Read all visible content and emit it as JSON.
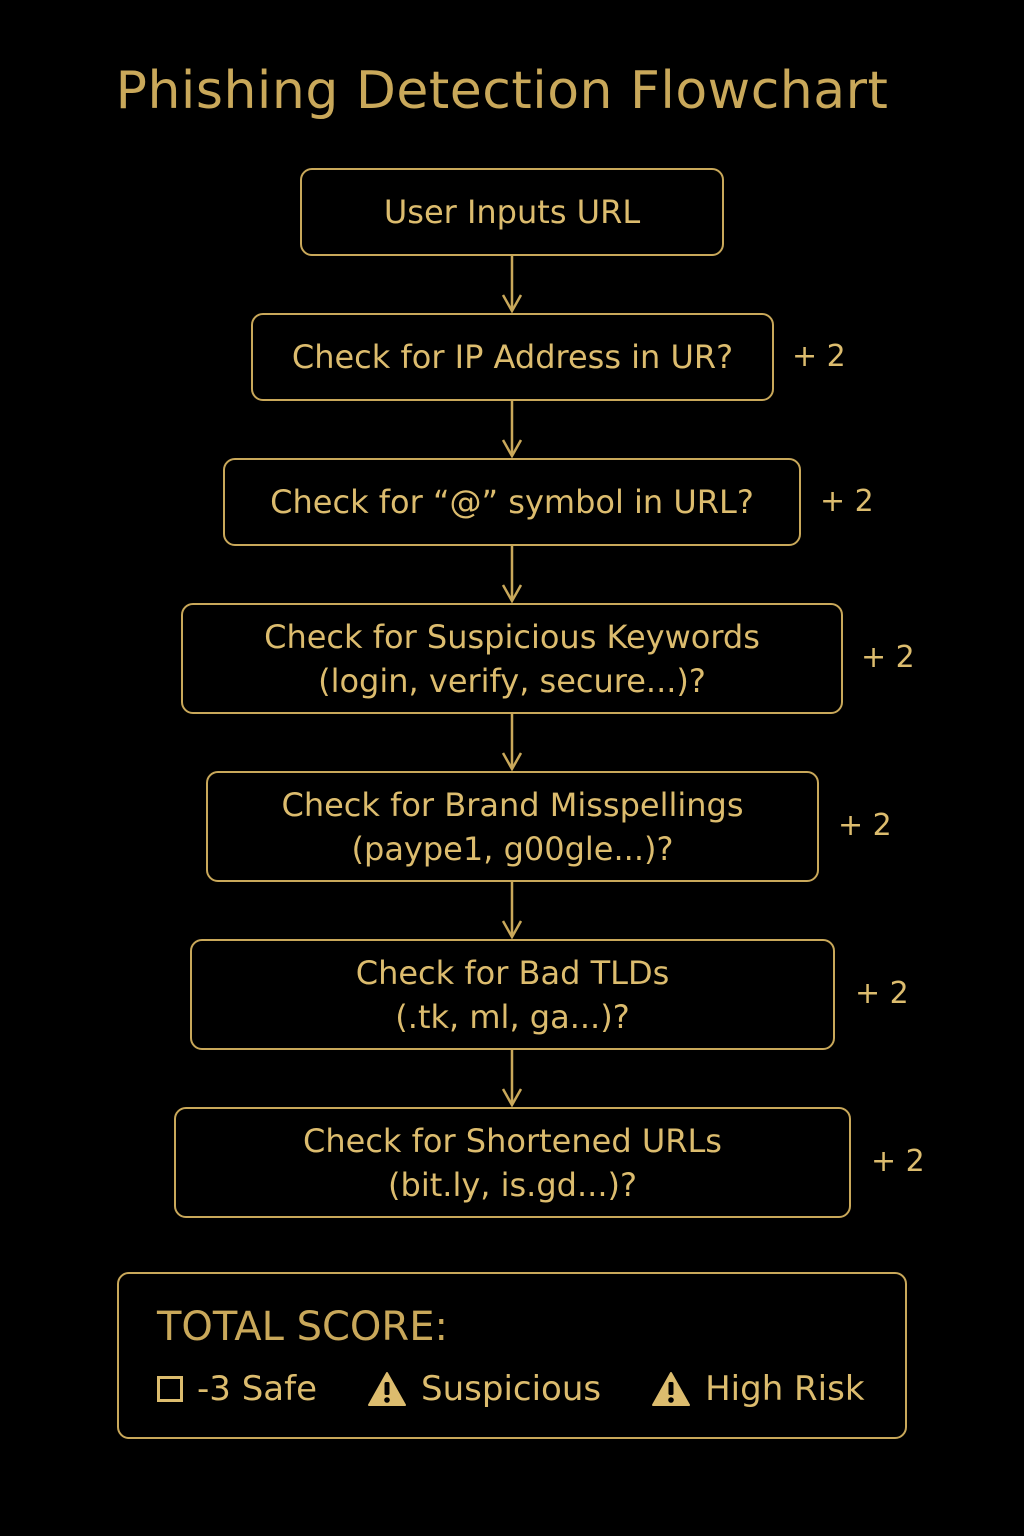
{
  "title": "Phishing Detection Flowchart",
  "steps": [
    {
      "lines": [
        "User Inputs URL"
      ],
      "score": ""
    },
    {
      "lines": [
        "Check for IP Address in UR?"
      ],
      "score": "+ 2"
    },
    {
      "lines": [
        "Check for “@” symbol in URL?"
      ],
      "score": "+ 2"
    },
    {
      "lines": [
        "Check for Suspicious Keywords",
        "(login, verify, secure...)?"
      ],
      "score": "+ 2"
    },
    {
      "lines": [
        "Check for Brand Misspellings",
        "(paype1, g00gle...)?"
      ],
      "score": "+ 2"
    },
    {
      "lines": [
        "Check for Bad TLDs",
        "(.tk, ml, ga...)?"
      ],
      "score": "+ 2"
    },
    {
      "lines": [
        "Check for Shortened URLs",
        "(bit.ly, is.gd...)?"
      ],
      "score": "+ 2"
    }
  ],
  "total": {
    "label": "TOTAL SCORE:",
    "legend": [
      {
        "icon": "checkbox-icon",
        "label": "-3 Safe"
      },
      {
        "icon": "warning-icon",
        "label": "Suspicious"
      },
      {
        "icon": "warning-icon",
        "label": "High Risk"
      }
    ]
  },
  "colors": {
    "background": "#000000",
    "accent": "#c9a85a",
    "text": "#dcbc6e"
  }
}
